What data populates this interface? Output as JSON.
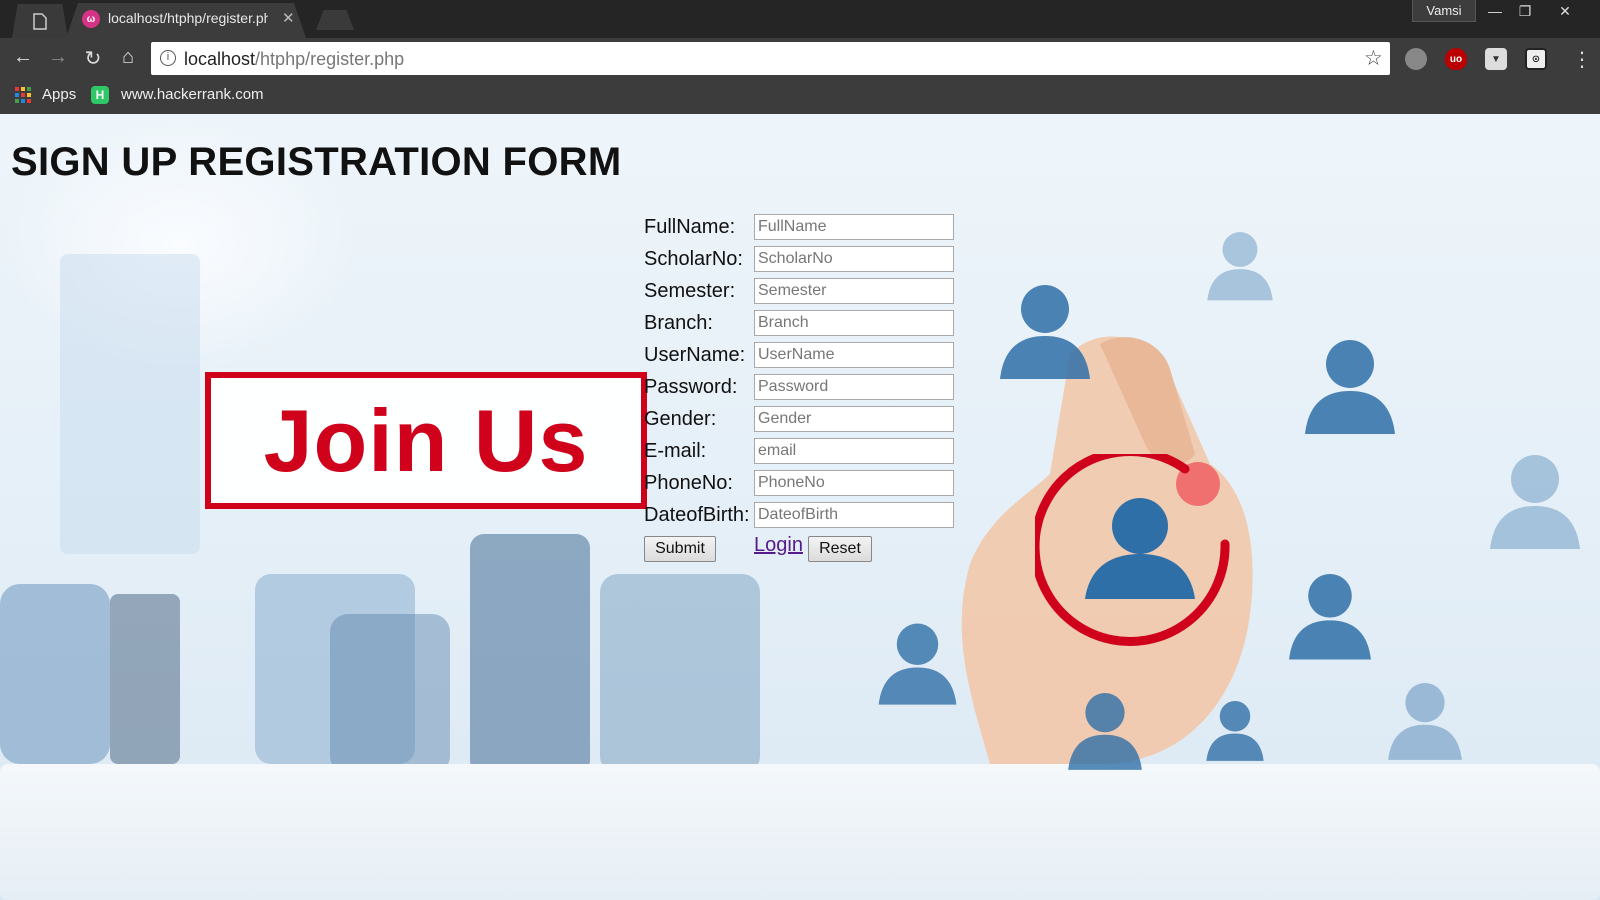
{
  "browser": {
    "tab_title": "localhost/htphp/register.php",
    "user": "Vamsi",
    "url_host": "localhost",
    "url_path": "/htphp/register.php",
    "bookmarks": [
      {
        "label": "Apps",
        "icon": "apps-grid-icon"
      },
      {
        "label": "www.hackerrank.com",
        "icon": "hackerrank-icon"
      }
    ]
  },
  "page": {
    "title": "SIGN UP REGISTRATION FORM",
    "banner": "Join Us"
  },
  "form": {
    "fields": [
      {
        "label": "FullName:",
        "placeholder": "FullName"
      },
      {
        "label": "ScholarNo:",
        "placeholder": "ScholarNo"
      },
      {
        "label": "Semester:",
        "placeholder": "Semester"
      },
      {
        "label": "Branch:",
        "placeholder": "Branch"
      },
      {
        "label": "UserName:",
        "placeholder": "UserName"
      },
      {
        "label": "Password:",
        "placeholder": "Password"
      },
      {
        "label": "Gender:",
        "placeholder": "Gender"
      },
      {
        "label": "E-mail:",
        "placeholder": "email"
      },
      {
        "label": "PhoneNo:",
        "placeholder": "PhoneNo"
      },
      {
        "label": "DateofBirth:",
        "placeholder": "DateofBirth"
      }
    ],
    "submit_label": "Submit",
    "login_label": "Login",
    "reset_label": "Reset"
  },
  "colors": {
    "accent_red": "#d0011b",
    "person_blue": "#2f6fa8"
  }
}
